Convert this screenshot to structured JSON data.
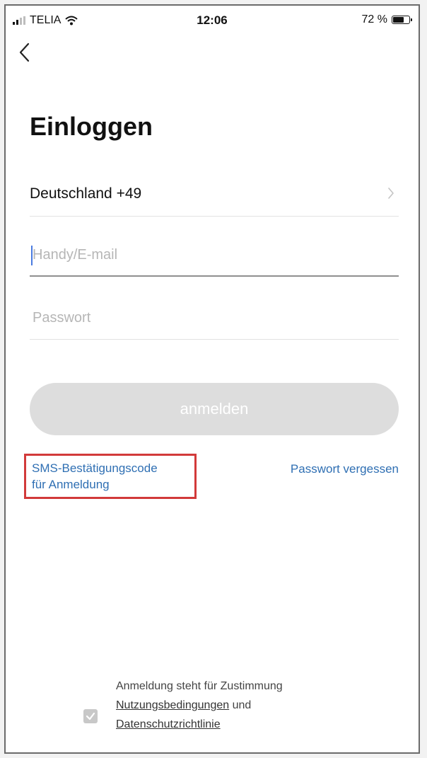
{
  "status_bar": {
    "carrier": "TELIA",
    "time": "12:06",
    "battery_text": "72 %",
    "battery_level": 0.72,
    "signal_bars": 2,
    "signal_icon": "cellular-signal-icon",
    "wifi_icon": "wifi-icon",
    "battery_icon": "battery-icon"
  },
  "nav": {
    "back_icon": "chevron-left-icon"
  },
  "page": {
    "title": "Einloggen"
  },
  "form": {
    "country_label": "Deutschland +49",
    "country_chevron_icon": "chevron-right-icon",
    "phone_placeholder": "Handy/E-mail",
    "phone_value": "",
    "password_placeholder": "Passwort",
    "password_value": "",
    "submit_label": "anmelden"
  },
  "links": {
    "sms_line1": "SMS-Bestätigungscode",
    "sms_line2": "für Anmeldung",
    "forgot": "Passwort vergessen"
  },
  "consent": {
    "checked": true,
    "text_prefix": "Anmeldung steht für Zustimmung",
    "terms": "Nutzungsbedingungen",
    "conjunction": "und",
    "privacy": "Datenschutzrichtlinie"
  },
  "colors": {
    "link": "#2f6fb3",
    "highlight_box": "#d23a3a",
    "button_disabled": "#dddddd"
  }
}
